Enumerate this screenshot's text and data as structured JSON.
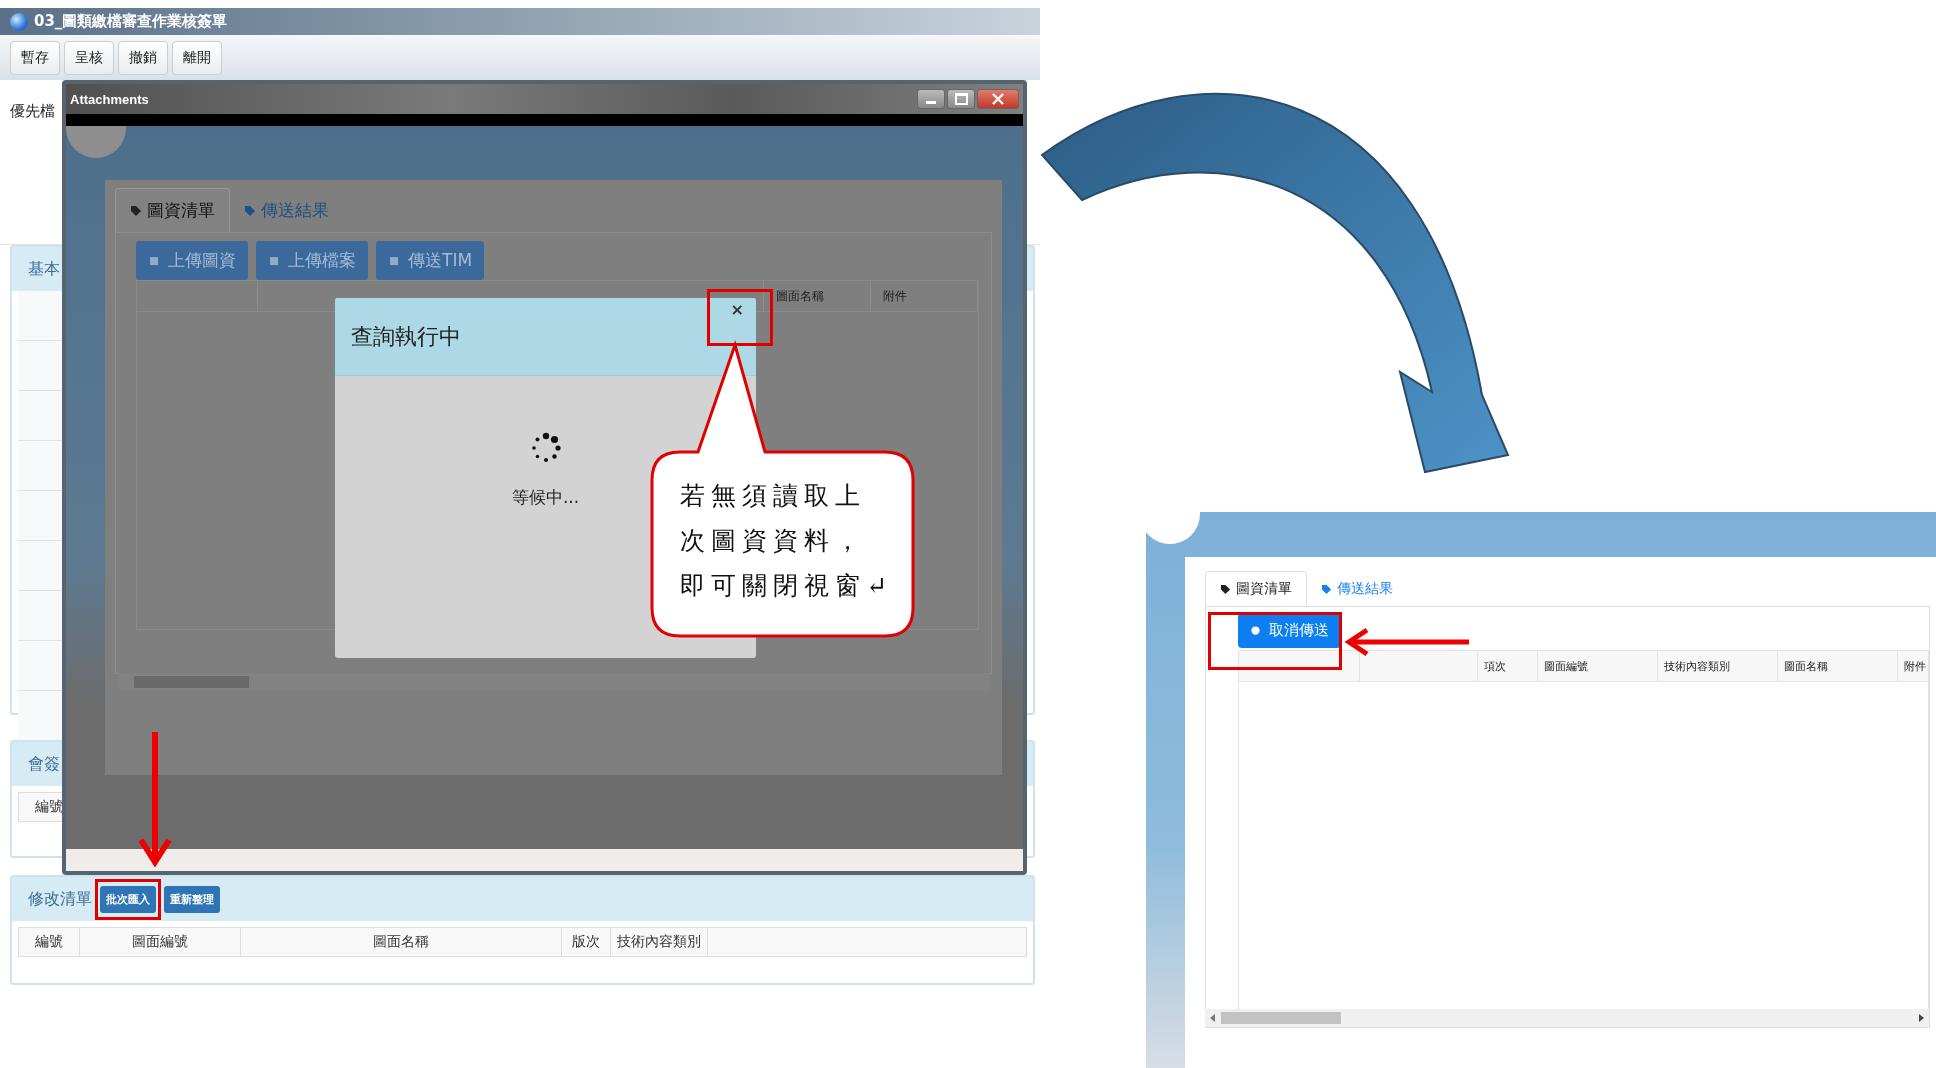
{
  "main_window": {
    "title": "03_圖類繳檔審查作業核簽單",
    "toolbar": [
      "暫存",
      "呈核",
      "撤銷",
      "離開"
    ],
    "priority_label": "優先檔",
    "sections": [
      {
        "title": "基本"
      },
      {
        "title": "會簽",
        "columns": [
          "編號"
        ]
      },
      {
        "title": "修改清單",
        "buttons": [
          {
            "label": "批次匯入",
            "highlighted": true
          },
          {
            "label": "重新整理",
            "highlighted": false
          }
        ],
        "columns": [
          "編號",
          "圖面編號",
          "圖面名稱",
          "版次",
          "技術內容類別"
        ]
      }
    ]
  },
  "attachments_window": {
    "title": "Attachments",
    "tabs": [
      {
        "label": "圖資清單",
        "selected": true
      },
      {
        "label": "傳送結果",
        "selected": false
      }
    ],
    "buttons": [
      "上傳圖資",
      "上傳檔案",
      "傳送TIM"
    ],
    "columns": [
      "圖面名稱",
      "附件"
    ],
    "dialog": {
      "title": "查詢執行中",
      "close": "×",
      "message": "等候中..."
    }
  },
  "callout": {
    "lines": [
      "若無須讀取上",
      "次圖資資料，",
      "即可關閉視窗↵"
    ]
  },
  "result_view": {
    "tabs": [
      {
        "label": "圖資清單",
        "selected": true
      },
      {
        "label": "傳送結果",
        "selected": false
      }
    ],
    "button": "取消傳送",
    "columns": [
      "項次",
      "圖面編號",
      "技術內容類別",
      "圖面名稱",
      "附件"
    ]
  }
}
